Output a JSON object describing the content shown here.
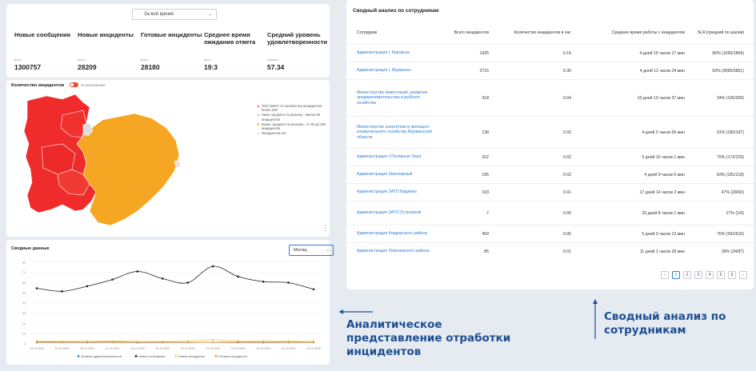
{
  "kpi": {
    "period": "За всё время",
    "items": [
      {
        "title": "Новые сообщения",
        "label": "Всего",
        "value": "1300757"
      },
      {
        "title": "Новые инциденты",
        "label": "Всего",
        "value": "28209"
      },
      {
        "title": "Готовые инциденты",
        "label": "Всего",
        "value": "28180"
      },
      {
        "title": "Среднее время ожидания ответа",
        "label": "Всего",
        "value": "19:3"
      },
      {
        "title": "Средний уровень удовлетворенности",
        "label": "Среднее",
        "value": "57.34"
      }
    ]
  },
  "map": {
    "title": "Количество инцидентов",
    "toggle_label": "% исполнения",
    "legend": [
      {
        "text": "ТОП ОМСУ по количеству инцидентов - более 200",
        "color": "#ef2b2b"
      },
      {
        "text": "Ниже среднего по региону - менее 60 инцидентов",
        "color": "#8fc441"
      },
      {
        "text": "Выше среднего по региону - от 60 до 200 инцидентов",
        "color": "#f4a623"
      },
      {
        "text": "Инцидентов нет",
        "color": "#cccccc"
      }
    ],
    "colors": {
      "top": "#ef2b2b",
      "above_avg": "#f5a623",
      "none": "#dcdcdc"
    }
  },
  "chart_data": {
    "type": "line",
    "title": "Сводные данные",
    "period_select": "Месяц",
    "categories": [
      "14.12.2020",
      "15.12.2020",
      "16.12.2020",
      "17.12.2020",
      "18.12.2020",
      "19.12.2020",
      "20.12.2020",
      "21.12.2020",
      "22.12.2020",
      "23.12.2020",
      "24.12.2020",
      "25.12.2020"
    ],
    "y_ticks": [
      "0",
      "1k",
      "2k",
      "3k",
      "4k",
      "5k",
      "6k",
      "7k",
      "8k"
    ],
    "ylim": [
      0,
      8000
    ],
    "series": [
      {
        "name": "Уровень удовлетворенности",
        "color": "#2f7fd6",
        "values": [
          180,
          170,
          160,
          190,
          150,
          170,
          150,
          160,
          170,
          160,
          170,
          150
        ]
      },
      {
        "name": "Новые сообщения",
        "color": "#222222",
        "values": [
          5450,
          5150,
          5650,
          6300,
          7100,
          6400,
          6000,
          7600,
          6600,
          6100,
          6000,
          5350
        ]
      },
      {
        "name": "Новые инциденты",
        "color": "#e6cf3a",
        "values": [
          300,
          250,
          280,
          270,
          260,
          240,
          280,
          400,
          300,
          280,
          270,
          300
        ]
      },
      {
        "name": "Готовые инциденты",
        "color": "#f08c2e",
        "values": [
          100,
          120,
          110,
          130,
          100,
          110,
          120,
          150,
          110,
          100,
          120,
          110
        ]
      }
    ]
  },
  "table": {
    "title": "Сводный анализ по сотрудникам",
    "columns": [
      "Сотрудник",
      "Всего инцидентов",
      "Количество инцидентов в час",
      "Среднее время работы с инцидентом",
      "SLA (средний по шагам)"
    ],
    "rows": [
      {
        "employee": "Администрация г. Кировска",
        "total": "1425",
        "per_hour": "0.16",
        "avg_time": "4 дней 15 часов 17 мин",
        "sla": "90% (1690/1869)"
      },
      {
        "employee": "Администрация г. Мурманск",
        "total": "2715",
        "per_hour": "0.30",
        "avg_time": "4 дней 11 часов 24 мин",
        "sla": "93% (3595/3851)"
      },
      {
        "employee": "Министерство инвестиций, развития предпринимательства и рыбного хозяйства",
        "total": "318",
        "per_hour": "0.04",
        "avg_time": "10 дней 13 часов 37 мин",
        "sla": "34% (106/309)"
      },
      {
        "employee": "Министерство энергетики и жилищно-коммунального хозяйства Мурманской области",
        "total": "138",
        "per_hour": "0.02",
        "avg_time": "4 дней 2 часов 56 мин",
        "sla": "91% (180/197)"
      },
      {
        "employee": "Администрация г.Полярные Зори",
        "total": "202",
        "per_hour": "0.02",
        "avg_time": "5 дней 10 часов 1 мин",
        "sla": "75% (172/229)"
      },
      {
        "employee": "Администрация Заполярный",
        "total": "195",
        "per_hour": "0.02",
        "avg_time": "4 дней 9 часов 6 мин",
        "sla": "83% (181/218)"
      },
      {
        "employee": "Администрация ЗАТО Видяево",
        "total": "103",
        "per_hour": "0.01",
        "avg_time": "17 дней 14 часов 2 мин",
        "sla": "47% (28/60)"
      },
      {
        "employee": "Администрация ЗАТО Островной",
        "total": "7",
        "per_hour": "0.00",
        "avg_time": "29 дней 8 часов 1 мин",
        "sla": "17% (1/6)"
      },
      {
        "employee": "Администрация Ковдорского района",
        "total": "493",
        "per_hour": "0.06",
        "avg_time": "5 дней 3 часов 13 мин",
        "sla": "76% (392/516)"
      },
      {
        "employee": "Администрация Ловозерского района",
        "total": "85",
        "per_hour": "0.01",
        "avg_time": "11 дней 1 часов 28 мин",
        "sla": "39% (34/87)"
      }
    ],
    "pages": [
      "1",
      "2",
      "3",
      "4",
      "5",
      "6"
    ],
    "active_page": "1",
    "prev_icon": "chevron-left-icon",
    "next_icon": "chevron-right-icon"
  },
  "annotations": {
    "analytic": "Аналитическое представление отработки инцидентов",
    "summary": "Сводный анализ по сотрудникам",
    "arrow_color": "#1d4e8f"
  }
}
